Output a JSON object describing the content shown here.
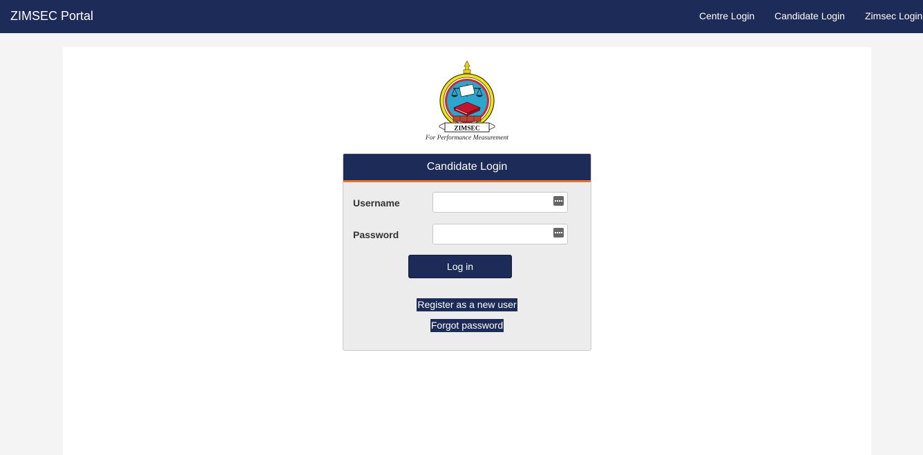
{
  "header": {
    "brand": "ZIMSEC Portal",
    "nav": [
      "Centre Login",
      "Candidate Login",
      "Zimsec Login"
    ],
    "bg_color": "#1c2b57"
  },
  "logo": {
    "banner_text": "ZIMSEC",
    "tagline": "For Performance Measurement"
  },
  "login_panel": {
    "title": "Candidate Login",
    "accent_color": "#e8742c",
    "username_label": "Username",
    "username_value": "",
    "password_label": "Password",
    "password_value": "",
    "field_icon": "password-manager-key-icon",
    "submit_label": "Log in",
    "register_link": "Register as a new user",
    "forgot_link": "Forgot password"
  }
}
